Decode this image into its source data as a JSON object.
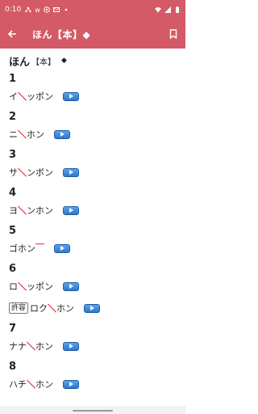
{
  "status_bar": {
    "time": "0:10",
    "notif_letters": "w"
  },
  "app_bar": {
    "title": "ほん【本】◆"
  },
  "headword": {
    "kana": "ほん",
    "kanji": "【本】",
    "symbol": "◆"
  },
  "entries": [
    {
      "num": "1",
      "rows": [
        {
          "allowed": "",
          "pre": "イ",
          "mark": "＼",
          "post": "ッポン",
          "macron": ""
        }
      ]
    },
    {
      "num": "2",
      "rows": [
        {
          "allowed": "",
          "pre": "ニ",
          "mark": "＼",
          "post": "ホン",
          "macron": ""
        }
      ]
    },
    {
      "num": "3",
      "rows": [
        {
          "allowed": "",
          "pre": "サ",
          "mark": "＼",
          "post": "ンボン",
          "macron": ""
        }
      ]
    },
    {
      "num": "4",
      "rows": [
        {
          "allowed": "",
          "pre": "ヨ",
          "mark": "＼",
          "post": "ンホン",
          "macron": ""
        }
      ]
    },
    {
      "num": "5",
      "rows": [
        {
          "allowed": "",
          "pre": "ゴホン",
          "mark": "",
          "post": "",
          "macron": "￣"
        }
      ]
    },
    {
      "num": "6",
      "rows": [
        {
          "allowed": "",
          "pre": "ロ",
          "mark": "＼",
          "post": "ッポン",
          "macron": ""
        },
        {
          "allowed": "許容",
          "pre": "ロク",
          "mark": "＼",
          "post": "ホン",
          "macron": ""
        }
      ]
    },
    {
      "num": "7",
      "rows": [
        {
          "allowed": "",
          "pre": "ナナ",
          "mark": "＼",
          "post": "ホン",
          "macron": ""
        }
      ]
    },
    {
      "num": "8",
      "rows": [
        {
          "allowed": "",
          "pre": "ハチ",
          "mark": "＼",
          "post": "ホン",
          "macron": ""
        }
      ]
    }
  ],
  "colors": {
    "app_bar": "#d35a66",
    "accent_mark": "#d81f2a",
    "play_button": "#2f78cc"
  }
}
